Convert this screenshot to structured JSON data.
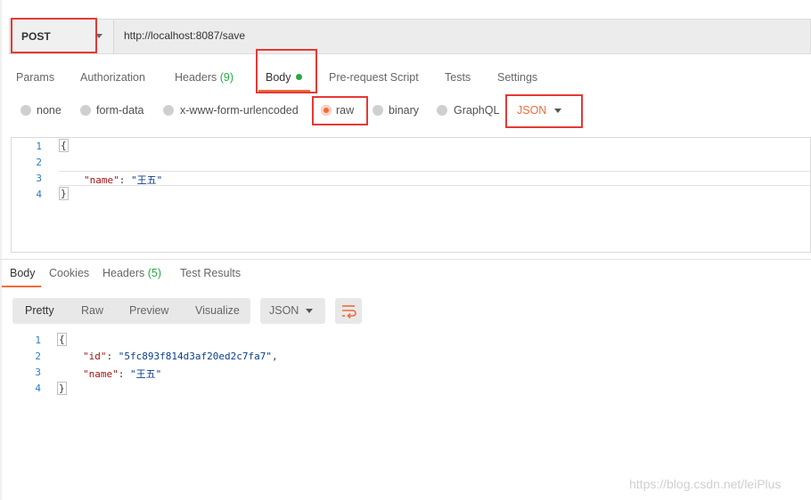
{
  "request": {
    "method": "POST",
    "url": "http://localhost:8087/save"
  },
  "request_tabs": {
    "params": "Params",
    "authorization": "Authorization",
    "headers": "Headers",
    "headers_count": "(9)",
    "body": "Body",
    "prerequest": "Pre-request Script",
    "tests": "Tests",
    "settings": "Settings"
  },
  "body_modes": {
    "none": "none",
    "form_data": "form-data",
    "urlencoded": "x-www-form-urlencoded",
    "raw": "raw",
    "binary": "binary",
    "graphql": "GraphQL",
    "format": "JSON",
    "selected": "raw"
  },
  "request_editor": {
    "line_numbers": [
      "1",
      "2",
      "3",
      "4"
    ],
    "open": "{",
    "key_name": "\"name\"",
    "colon": ": ",
    "value_name": "\"王五\"",
    "close": "}"
  },
  "response_tabs": {
    "body": "Body",
    "cookies": "Cookies",
    "headers": "Headers",
    "headers_count": "(5)",
    "test_results": "Test Results"
  },
  "response_format": {
    "pretty": "Pretty",
    "raw": "Raw",
    "preview": "Preview",
    "visualize": "Visualize",
    "type": "JSON"
  },
  "response_body": {
    "line_numbers": [
      "1",
      "2",
      "3",
      "4"
    ],
    "open": "{",
    "key_id": "\"id\"",
    "value_id": "\"5fc893f814d3af20ed2c7fa7\"",
    "comma": ",",
    "key_name": "\"name\"",
    "value_name": "\"王五\"",
    "colon": ": ",
    "close": "}"
  },
  "watermark": "https://blog.csdn.net/leiPlus",
  "colors": {
    "accent": "#f26b3a",
    "highlight": "#e53935",
    "count_green": "#27a844"
  },
  "icons": [
    "chevron-down-icon",
    "radio-icon",
    "wrap-lines-icon"
  ]
}
